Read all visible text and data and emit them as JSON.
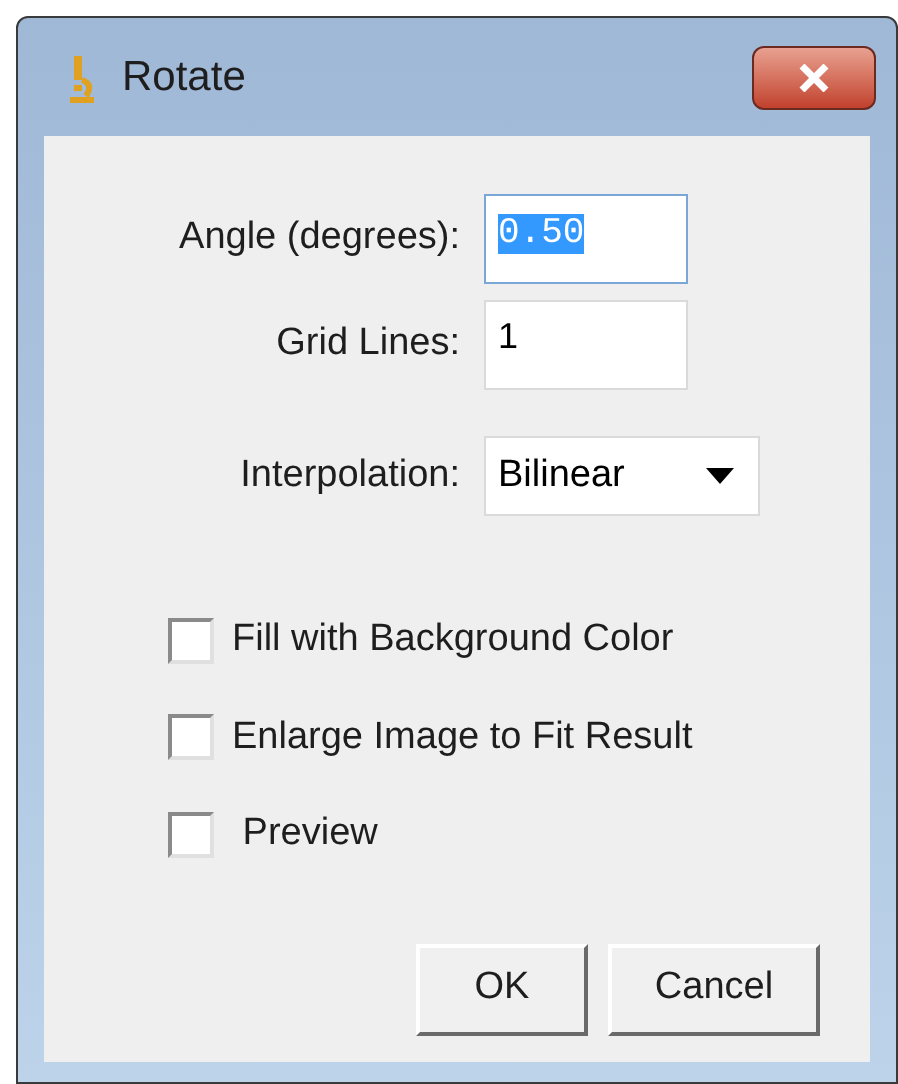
{
  "window": {
    "title": "Rotate"
  },
  "fields": [
    {
      "label": "Angle (degrees):",
      "value": "0.50",
      "focused": true,
      "text_selected": true
    },
    {
      "label": "Grid Lines:",
      "value": "1",
      "focused": false,
      "text_selected": false
    }
  ],
  "dropdown": {
    "label": "Interpolation:",
    "value": "Bilinear"
  },
  "checkboxes": [
    {
      "label": "Fill with Background Color",
      "checked": false
    },
    {
      "label": "Enlarge Image to Fit Result",
      "checked": false
    },
    {
      "label": " Preview",
      "checked": false
    }
  ],
  "buttons": [
    "OK",
    "Cancel"
  ]
}
